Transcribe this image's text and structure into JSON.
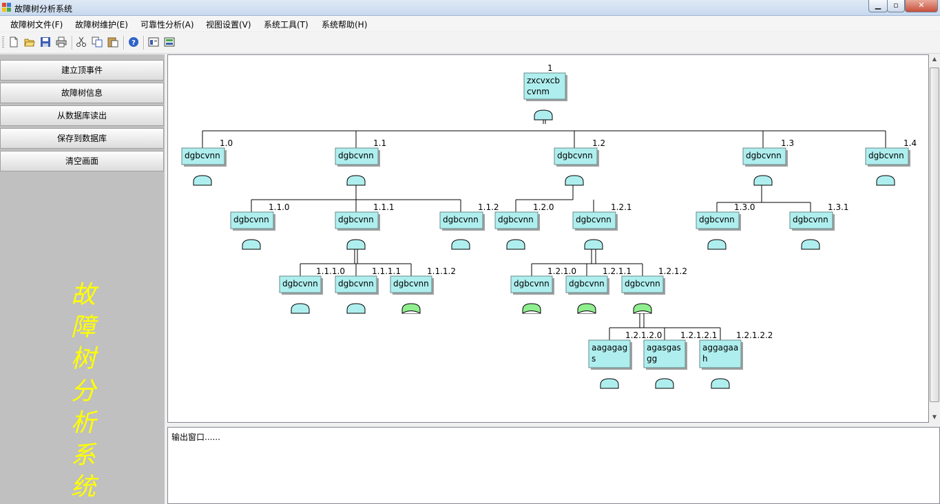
{
  "window": {
    "title": "故障树分析系统"
  },
  "menu": [
    "故障树文件(F)",
    "故障树维护(E)",
    "可靠性分析(A)",
    "视图设置(V)",
    "系统工具(T)",
    "系统帮助(H)"
  ],
  "toolbar": [
    "new-icon",
    "open-folder-icon",
    "save-icon",
    "print-icon",
    "cut-icon",
    "copy-icon",
    "paste-icon",
    "help-icon",
    "view-tree-icon",
    "refresh-icon"
  ],
  "side_buttons": [
    "建立顶事件",
    "故障树信息",
    "从数据库读出",
    "保存到数据库",
    "清空画面"
  ],
  "side_title": "故障树分析系统",
  "output": {
    "text": "输出窗口......"
  },
  "colors": {
    "node_fill": "#afeeee",
    "gate_fill": "#afeeee",
    "gate_green": "#90ee90",
    "side_title": "#ffff00",
    "panel": "#c0c0c0"
  },
  "tree": {
    "root": {
      "id": "1",
      "label": [
        "zxcvxcb",
        "cvnm"
      ]
    },
    "level1": [
      {
        "id": "1.0",
        "label": [
          "dgbcvnn"
        ]
      },
      {
        "id": "1.1",
        "label": [
          "dgbcvnn"
        ]
      },
      {
        "id": "1.2",
        "label": [
          "dgbcvnn"
        ]
      },
      {
        "id": "1.3",
        "label": [
          "dgbcvnn"
        ]
      },
      {
        "id": "1.4",
        "label": [
          "dgbcvnn"
        ]
      }
    ],
    "level2": [
      {
        "id": "1.1.0",
        "label": [
          "dgbcvnn"
        ]
      },
      {
        "id": "1.1.1",
        "label": [
          "dgbcvnn"
        ]
      },
      {
        "id": "1.1.2",
        "label": [
          "dgbcvnn"
        ]
      },
      {
        "id": "1.2.0",
        "label": [
          "dgbcvnn"
        ]
      },
      {
        "id": "1.2.1",
        "label": [
          "dgbcvnn"
        ]
      },
      {
        "id": "1.3.0",
        "label": [
          "dgbcvnn"
        ]
      },
      {
        "id": "1.3.1",
        "label": [
          "dgbcvnn"
        ]
      }
    ],
    "level3": [
      {
        "id": "1.1.1.0",
        "label": [
          "dgbcvnn"
        ]
      },
      {
        "id": "1.1.1.1",
        "label": [
          "dgbcvnn"
        ]
      },
      {
        "id": "1.1.1.2",
        "label": [
          "dgbcvnn"
        ]
      },
      {
        "id": "1.2.1.0",
        "label": [
          "dgbcvnn"
        ]
      },
      {
        "id": "1.2.1.1",
        "label": [
          "dgbcvnn"
        ]
      },
      {
        "id": "1.2.1.2",
        "label": [
          "dgbcvnn"
        ]
      }
    ],
    "level4": [
      {
        "id": "1.2.1.2.0",
        "label": [
          "aagagag",
          "s"
        ]
      },
      {
        "id": "1.2.1.2.1",
        "label": [
          "agasgas",
          "gg"
        ]
      },
      {
        "id": "1.2.1.2.2",
        "label": [
          "aggagaa",
          "h"
        ]
      }
    ]
  }
}
